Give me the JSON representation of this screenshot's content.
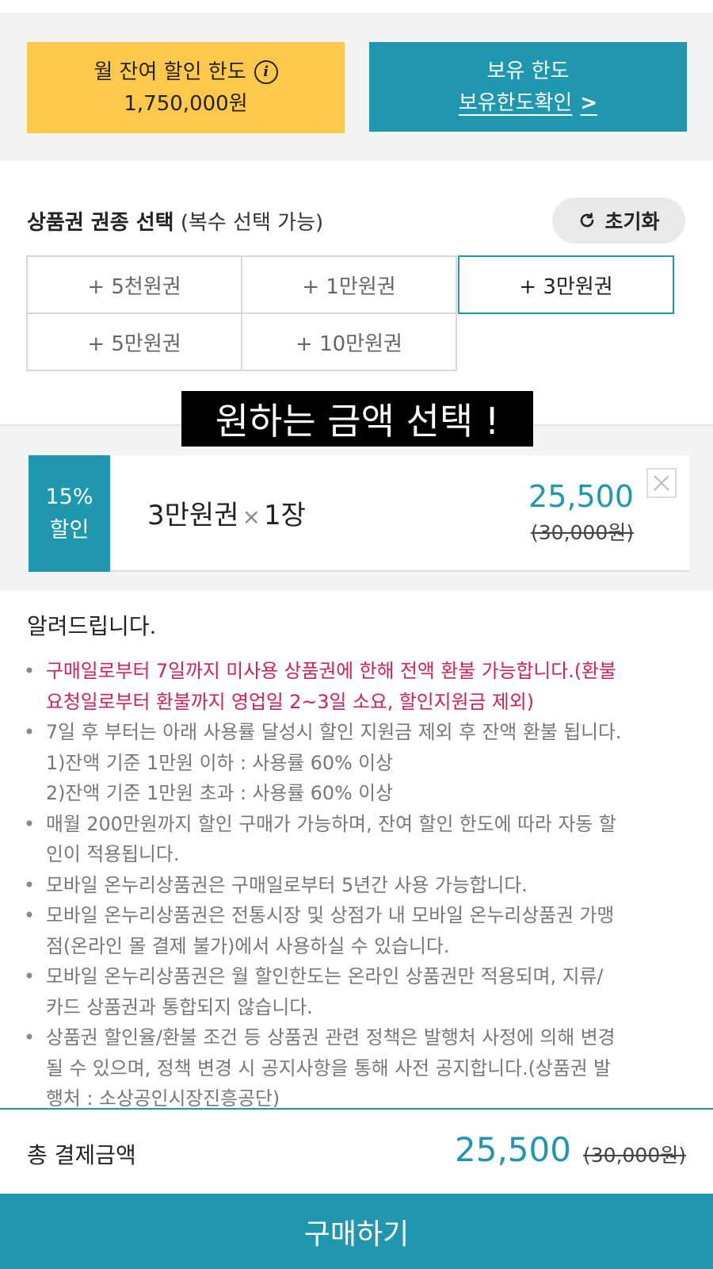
{
  "limits": {
    "monthly_label": "월 잔여 할인 한도",
    "monthly_amount": "1,750,000원",
    "holding_label": "보유 한도",
    "holding_link": "보유한도확인",
    "chevron": ">",
    "info_glyph": "i"
  },
  "selection": {
    "title": "상품권 권종 선택",
    "subtitle": "(복수 선택 가능)",
    "reset_label": "초기화",
    "options": [
      {
        "label": "+ 5천원권",
        "selected": false
      },
      {
        "label": "+ 1만원권",
        "selected": false
      },
      {
        "label": "+ 3만원권",
        "selected": true
      },
      {
        "label": "+ 5만원권",
        "selected": false
      },
      {
        "label": "+ 10만원권",
        "selected": false
      }
    ]
  },
  "banner": "원하는 금액 선택 !",
  "selected_item": {
    "discount_rate": "15%",
    "discount_label": "할인",
    "name": "3만원권",
    "times": "×",
    "quantity": "1장",
    "price": "25,500",
    "original_price": "(30,000원)"
  },
  "notice": {
    "title": "알려드립니다.",
    "items": [
      {
        "lines": [
          "구매일로부터 7일까지 미사용 상품권에 한해 전액 환불 가능합니다.(환불",
          "요청일로부터 환불까지 영업일 2~3일 소요, 할인지원금 제외)"
        ],
        "highlight": true
      },
      {
        "lines": [
          "7일 후 부터는 아래 사용률 달성시 할인 지원금 제외 후 잔액 환불 됩니다.",
          "1)잔액 기준 1만원 이하 : 사용률 60% 이상",
          "2)잔액 기준 1만원 초과 : 사용률 60% 이상"
        ],
        "highlight": false
      },
      {
        "lines": [
          "매월 200만원까지 할인 구매가 가능하며, 잔여 할인 한도에 따라 자동 할",
          "인이 적용됩니다."
        ],
        "highlight": false
      },
      {
        "lines": [
          "모바일 온누리상품권은 구매일로부터 5년간 사용 가능합니다."
        ],
        "highlight": false
      },
      {
        "lines": [
          "모바일 온누리상품권은 전통시장 및 상점가 내 모바일 온누리상품권 가맹",
          "점(온라인 몰 결제 불가)에서 사용하실 수 있습니다."
        ],
        "highlight": false
      },
      {
        "lines": [
          "모바일 온누리상품권은 월 할인한도는 온라인 상품권만 적용되며, 지류/",
          "카드 상품권과 통합되지 않습니다."
        ],
        "highlight": false
      },
      {
        "lines": [
          "상품권 할인율/환불 조건 등 상품권 관련 정책은 발행처 사정에 의해 변경",
          "될 수 있으며, 정책 변경 시 공지사항을 통해 사전 공지합니다.(상품권 발",
          "행처 : 소상공인시장진흥공단)"
        ],
        "highlight": false
      }
    ]
  },
  "total": {
    "label": "총 결제금액",
    "price": "25,500",
    "original_price": "(30,000원)"
  },
  "buy_button": "구매하기",
  "colors": {
    "accent": "#1f97ae",
    "limit_yellow": "#fec84b",
    "notice_red": "#d51e5a"
  },
  "icons": {
    "info": "info-icon",
    "reset": "refresh-icon",
    "close": "close-icon",
    "link_arrow": "chevron-right-icon"
  }
}
